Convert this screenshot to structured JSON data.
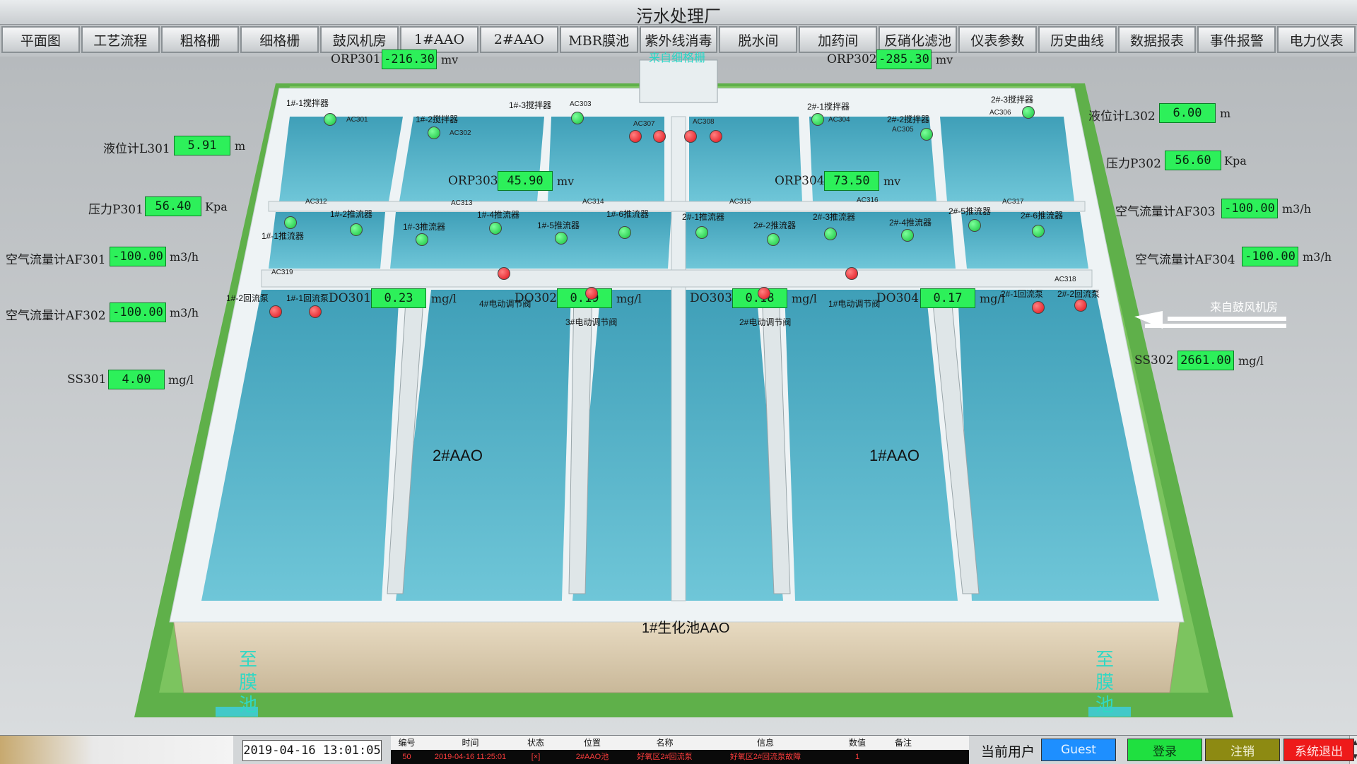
{
  "app": {
    "title": "污水处理厂"
  },
  "nav": [
    "平面图",
    "工艺流程",
    "粗格栅",
    "细格栅",
    "鼓风机房",
    "1#AAO",
    "2#AAO",
    "MBR膜池",
    "紫外线消毒",
    "脱水间",
    "加药间",
    "反硝化滤池",
    "仪表参数",
    "历史曲线",
    "数据报表",
    "事件报警",
    "电力仪表"
  ],
  "scene": {
    "inlet_label": "来自细格栅",
    "blower_label": "来自鼓风机房",
    "tank_left": "2#AAO",
    "tank_right": "1#AAO",
    "main_label": "1#生化池AAO",
    "outlet_left": "至膜池",
    "outlet_right": "至膜池"
  },
  "instruments": {
    "orp301": {
      "label": "ORP301",
      "value": "-216.30",
      "unit": "mv"
    },
    "orp302": {
      "label": "ORP302",
      "value": "-285.30",
      "unit": "mv"
    },
    "orp303": {
      "label": "ORP303",
      "value": "45.90",
      "unit": "mv"
    },
    "orp304": {
      "label": "ORP304",
      "value": "73.50",
      "unit": "mv"
    },
    "l301": {
      "label": "液位计L301",
      "value": "5.91",
      "unit": "m"
    },
    "l302": {
      "label": "液位计L302",
      "value": "6.00",
      "unit": "m"
    },
    "p301": {
      "label": "压力P301",
      "value": "56.40",
      "unit": "Kpa"
    },
    "p302": {
      "label": "压力P302",
      "value": "56.60",
      "unit": "Kpa"
    },
    "af301": {
      "label": "空气流量计AF301",
      "value": "-100.00",
      "unit": "m3/h"
    },
    "af302": {
      "label": "空气流量计AF302",
      "value": "-100.00",
      "unit": "m3/h"
    },
    "af303": {
      "label": "空气流量计AF303",
      "value": "-100.00",
      "unit": "m3/h"
    },
    "af304": {
      "label": "空气流量计AF304",
      "value": "-100.00",
      "unit": "m3/h"
    },
    "ss301": {
      "label": "SS301",
      "value": "4.00",
      "unit": "mg/l"
    },
    "ss302": {
      "label": "SS302",
      "value": "2661.00",
      "unit": "mg/l"
    },
    "do301": {
      "label": "DO301",
      "value": "0.23",
      "unit": "mg/l"
    },
    "do302": {
      "label": "DO302",
      "value": "0.19",
      "unit": "mg/l"
    },
    "do303": {
      "label": "DO303",
      "value": "0.18",
      "unit": "mg/l"
    },
    "do304": {
      "label": "DO304",
      "value": "0.17",
      "unit": "mg/l"
    }
  },
  "equipment": {
    "m1_1": "1#-1搅拌器",
    "m1_2": "1#-2搅拌器",
    "m1_3": "1#-3搅拌器",
    "m2_1": "2#-1搅拌器",
    "m2_2": "2#-2搅拌器",
    "m2_3": "2#-3搅拌器",
    "p1_1": "1#-1推流器",
    "p1_2": "1#-2推流器",
    "p1_3": "1#-3推流器",
    "p1_4": "1#-4推流器",
    "p1_5": "1#-5推流器",
    "p1_6": "1#-6推流器",
    "p2_1": "2#-1推流器",
    "p2_2": "2#-2推流器",
    "p2_3": "2#-3推流器",
    "p2_4": "2#-4推流器",
    "p2_5": "2#-5推流器",
    "p2_6": "2#-6推流器",
    "r1_1": "1#-1回流泵",
    "r1_2": "1#-2回流泵",
    "r2_1": "2#-1回流泵",
    "r2_2": "2#-2回流泵",
    "v1": "1#电动调节阀",
    "v2": "2#电动调节阀",
    "v3": "3#电动调节阀",
    "v4": "4#电动调节阀"
  },
  "codes": {
    "ac301": "AC301",
    "ac302": "AC302",
    "ac303": "AC303",
    "ac304": "AC304",
    "ac305": "AC305",
    "ac306": "AC306",
    "ac307": "AC307",
    "ac308": "AC308",
    "ac312": "AC312",
    "ac313": "AC313",
    "ac314": "AC314",
    "ac315": "AC315",
    "ac316": "AC316",
    "ac317": "AC317",
    "ac318": "AC318",
    "ac319": "AC319"
  },
  "status_colors": {
    "running": "#17c23f",
    "stopped": "#e0101a",
    "value_bg": "#2df05a"
  },
  "bottom": {
    "datetime": "2019-04-16 13:01:05",
    "alarm_headers": [
      "编号",
      "时间",
      "状态",
      "位置",
      "名称",
      "信息",
      "数值",
      "备注"
    ],
    "alarm_row": [
      "50",
      "2019-04-16 11:25:01",
      "[×]",
      "2#AAO池",
      "好氧区2#回流泵",
      "好氧区2#回流泵故障",
      "1",
      ""
    ],
    "user_label": "当前用户",
    "user_name": "Guest",
    "login": "登录",
    "logout": "注销",
    "exit": "系统退出"
  }
}
